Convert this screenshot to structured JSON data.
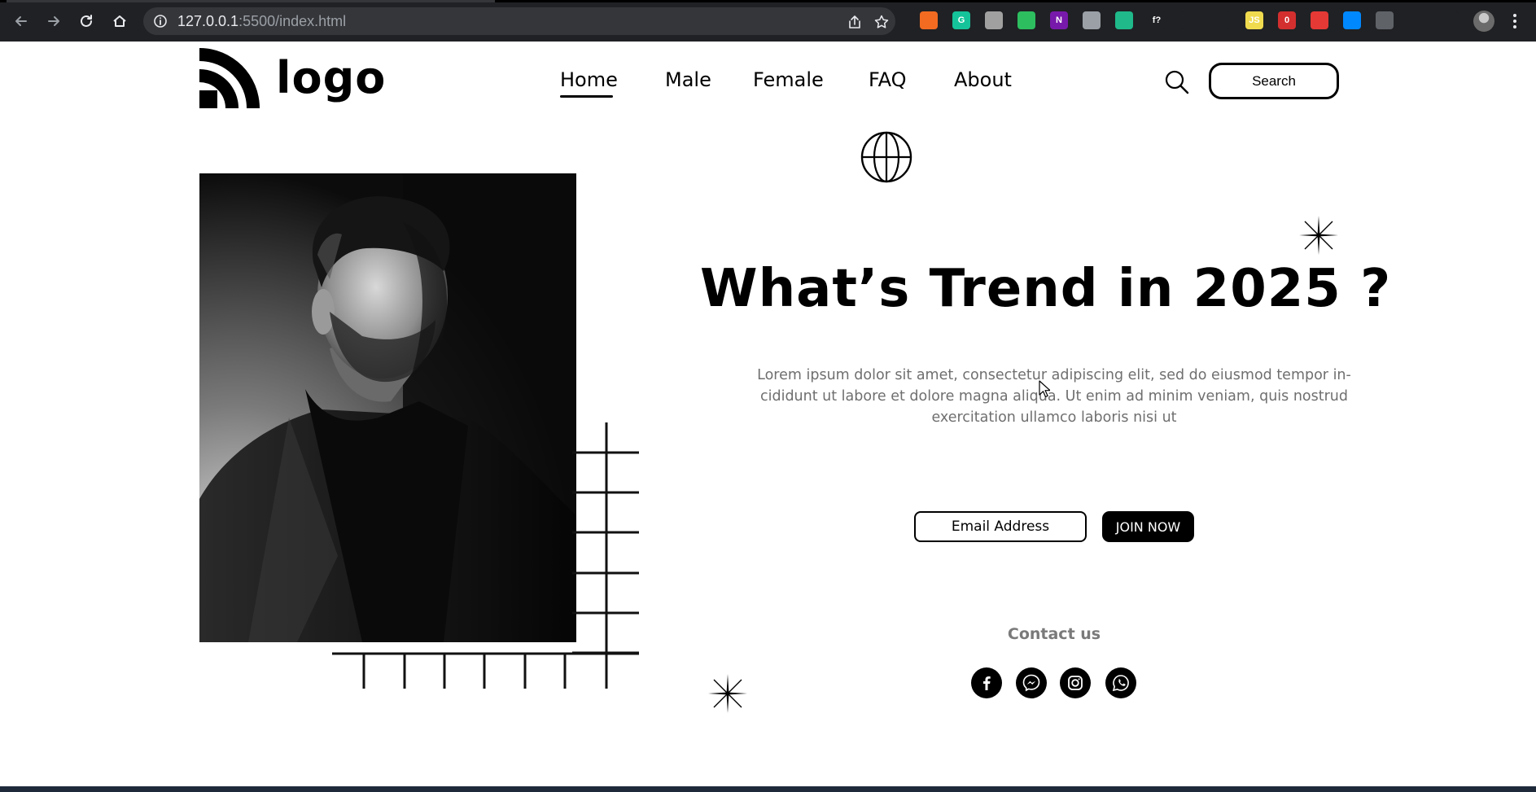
{
  "browser": {
    "url_host": "127.0.0.1",
    "url_rest": ":5500/index.html",
    "nav_icons": [
      "back-icon",
      "forward-icon",
      "reload-icon",
      "home-icon"
    ],
    "omnibox_icons": [
      "site-info-icon",
      "share-icon",
      "bookmark-star-icon"
    ],
    "extensions": [
      {
        "name": "extension-orange-icon",
        "label": "",
        "color": "#f26b21"
      },
      {
        "name": "grammarly-icon",
        "label": "G",
        "color": "#15c39a"
      },
      {
        "name": "color-picker-icon",
        "label": "",
        "color": "#a0a0a0"
      },
      {
        "name": "evernote-icon",
        "label": "",
        "color": "#2dbe60"
      },
      {
        "name": "onenote-icon",
        "label": "N",
        "color": "#7719aa"
      },
      {
        "name": "extension-owl-icon",
        "label": "",
        "color": "#9aa0a6"
      },
      {
        "name": "extension-green-icon",
        "label": "",
        "color": "#1fb98a"
      },
      {
        "name": "font-finder-icon",
        "label": "f?",
        "color": "#202124"
      },
      {
        "name": "picture-in-picture-icon",
        "label": "",
        "color": "#202124"
      },
      {
        "name": "react-devtools-icon",
        "label": "",
        "color": "#202124"
      },
      {
        "name": "js-icon",
        "label": "JS",
        "color": "#f0db4f"
      },
      {
        "name": "extension-red-target-icon",
        "label": "0",
        "color": "#d32f2f"
      },
      {
        "name": "extension-hand-icon",
        "label": "",
        "color": "#e53935"
      },
      {
        "name": "shazam-icon",
        "label": "",
        "color": "#0088ff"
      },
      {
        "name": "extension-grey-icon",
        "label": "",
        "color": "#5f6368"
      },
      {
        "name": "extensions-puzzle-icon",
        "label": "",
        "color": "#202124"
      },
      {
        "name": "side-panel-icon",
        "label": "",
        "color": "#202124"
      }
    ]
  },
  "header": {
    "logo_text": "logo",
    "nav": [
      {
        "label": "Home",
        "active": true
      },
      {
        "label": "Male",
        "active": false
      },
      {
        "label": "Female",
        "active": false
      },
      {
        "label": "FAQ",
        "active": false
      },
      {
        "label": "About",
        "active": false
      }
    ],
    "search_button": "Search"
  },
  "hero": {
    "title": "What’s Trend in 2025 ?",
    "lead": "Lorem ipsum dolor sit amet, consectetur adipiscing elit, sed do eiusmod tempor in-cididunt ut labore et dolore magna aliqua. Ut enim ad minim veniam, quis nostrud exercitation ullamco laboris nisi ut",
    "email_placeholder": "Email Address",
    "join_label": "JOIN NOW"
  },
  "contact": {
    "title": "Contact us",
    "socials": [
      "facebook-icon",
      "messenger-icon",
      "instagram-icon",
      "whatsapp-icon"
    ]
  },
  "colors": {
    "chrome_bg": "#202124",
    "omnibox_bg": "#35363a",
    "text_primary": "#000000",
    "text_muted": "#6f6f6f",
    "contact_heading": "#7a7a7a"
  }
}
